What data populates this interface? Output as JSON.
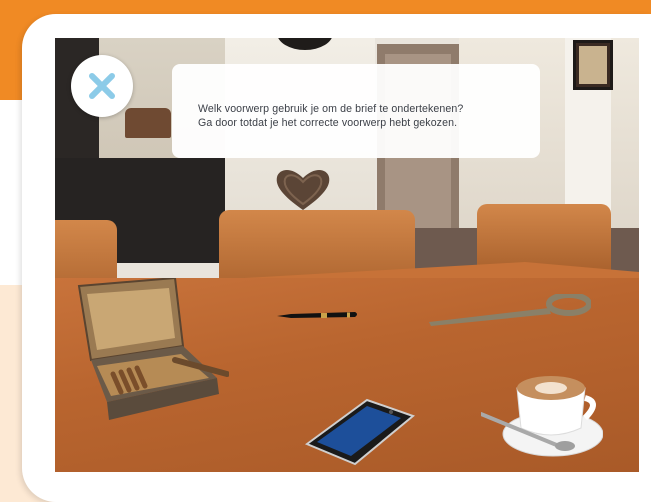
{
  "instruction": {
    "line1": "Welk voorwerp gebruik je om de brief te ondertekenen?",
    "line2": "Ga door totdat je het correcte voorwerp hebt gekozen."
  },
  "close_button": {
    "icon": "close-icon",
    "color": "#8ccbe8"
  },
  "objects": [
    "cigar-box",
    "pen",
    "key",
    "smartphone",
    "cappuccino-cup"
  ],
  "colors": {
    "accent_orange": "#f08a24",
    "table_wood": "#b9652f"
  }
}
